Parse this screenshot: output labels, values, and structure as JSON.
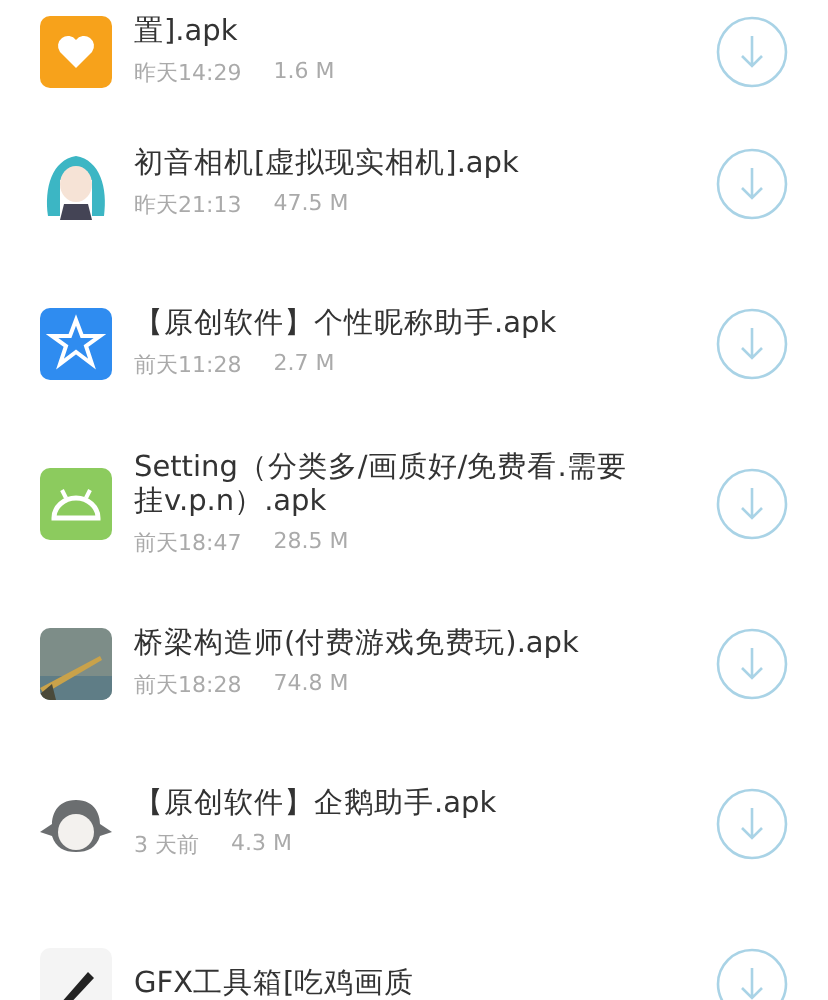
{
  "files": [
    {
      "kind": "heart",
      "name": "置].apk",
      "time": "昨天14:29",
      "size": "1.6 M"
    },
    {
      "kind": "figure",
      "name": "初音相机[虚拟现实相机].apk",
      "time": "昨天21:13",
      "size": "47.5 M"
    },
    {
      "kind": "star",
      "name": "【原创软件】个性昵称助手.apk",
      "time": "前天11:28",
      "size": "2.7 M"
    },
    {
      "kind": "android",
      "name": "Setting（分类多/画质好/免费看.需要挂v.p.n）.apk",
      "time": "前天18:47",
      "size": "28.5 M"
    },
    {
      "kind": "picture",
      "name": "桥梁构造师(付费游戏免费玩).apk",
      "time": "前天18:28",
      "size": "74.8 M"
    },
    {
      "kind": "penguin",
      "name": "【原创软件】企鹅助手.apk",
      "time": "3 天前",
      "size": "4.3 M"
    },
    {
      "kind": "tool",
      "name": "GFX工具箱[吃鸡画质"
    }
  ]
}
